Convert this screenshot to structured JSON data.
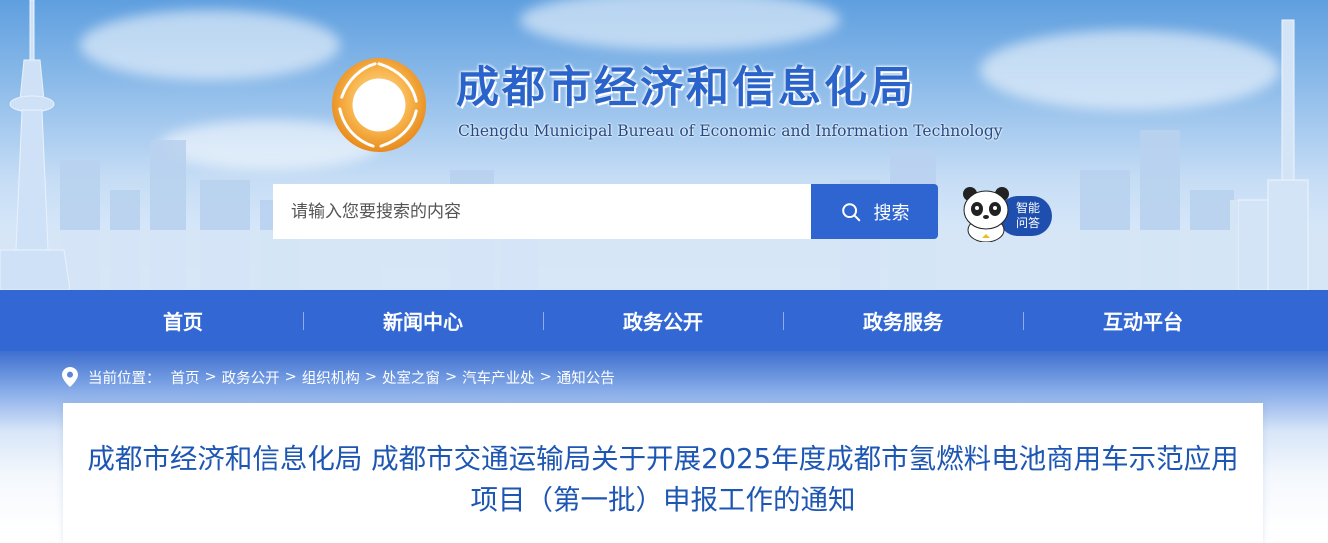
{
  "header": {
    "title": "成都市经济和信息化局",
    "subtitle": "Chengdu Municipal Bureau of Economic and Information Technology",
    "emblem_icon": "bureau-logo-emblem",
    "search": {
      "placeholder": "请输入您要搜索的内容",
      "value": "",
      "button_label": "搜索",
      "button_icon": "search-icon"
    },
    "assistant": {
      "line1": "智能",
      "line2": "问答",
      "icon": "panda-mascot-icon"
    }
  },
  "nav": {
    "items": [
      {
        "label": "首页"
      },
      {
        "label": "新闻中心"
      },
      {
        "label": "政务公开"
      },
      {
        "label": "政务服务"
      },
      {
        "label": "互动平台"
      }
    ]
  },
  "breadcrumb": {
    "icon": "location-pin-icon",
    "prefix": "当前位置：",
    "items": [
      "首页",
      "政务公开",
      "组织机构",
      "处室之窗",
      "汽车产业处",
      "通知公告"
    ],
    "separator": ">"
  },
  "article": {
    "title": "成都市经济和信息化局 成都市交通运输局关于开展2025年度成都市氢燃料电池商用车示范应用项目（第一批）申报工作的通知"
  },
  "colors": {
    "primary": "#3368d4",
    "title_blue": "#2a63c9",
    "article_title": "#1d56b3",
    "search_button": "#2f65d0"
  }
}
